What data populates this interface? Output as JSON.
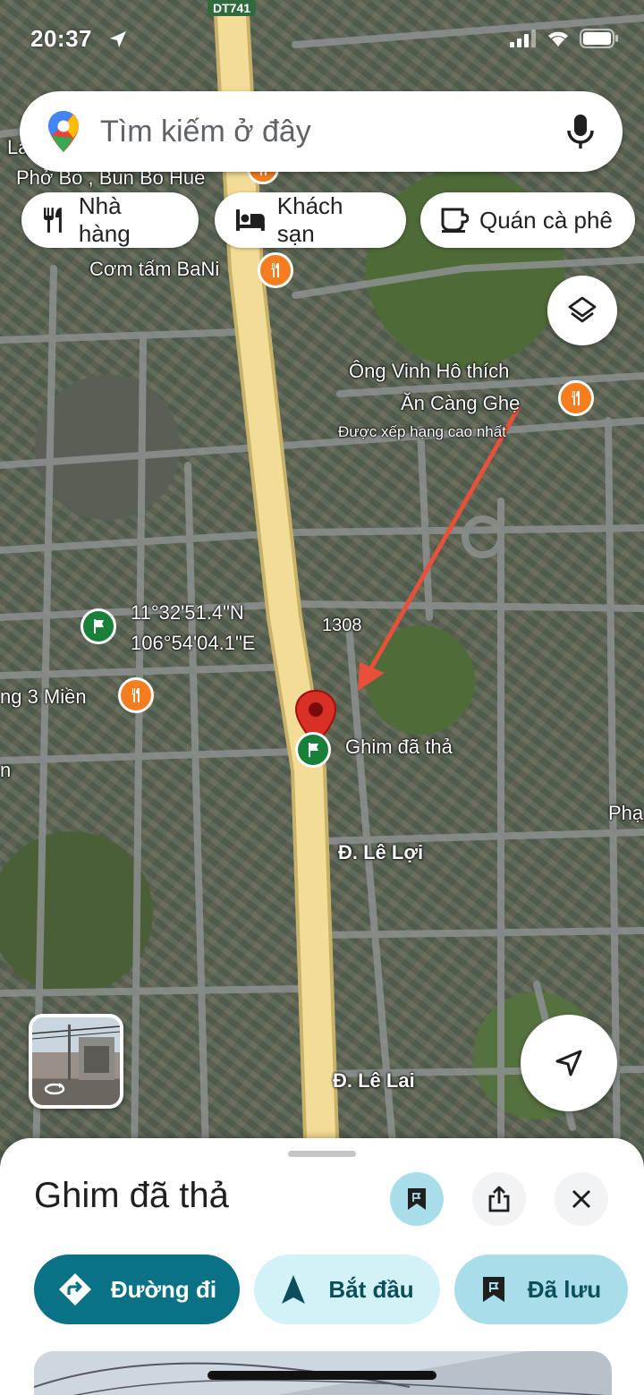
{
  "status_bar": {
    "time": "20:37"
  },
  "search": {
    "placeholder": "Tìm kiếm ở đây"
  },
  "chips": [
    {
      "label": "Nhà hàng",
      "icon": "restaurant-icon"
    },
    {
      "label": "Khách sạn",
      "icon": "hotel-icon"
    },
    {
      "label": "Quán cà phê",
      "icon": "coffee-icon"
    }
  ],
  "map": {
    "route_shield": "DT741",
    "labels": {
      "pho_bo": "Phở Bò , Bún Bò Huế",
      "la": "La",
      "com_tam": "Cơm tấm BaNi",
      "ong_vinh_1": "Ông Vinh Hô thích",
      "ong_vinh_2": "Ăn Càng Ghẹ",
      "top_rated": "Được xếp hạng cao nhất",
      "coord_lat": "11°32'51.4\"N",
      "coord_lng": "106°54'04.1\"E",
      "num_1308": "1308",
      "ong3mien": "ng 3 Miền",
      "n_edge": "n",
      "pin_label": "Ghim đã thả",
      "le_loi": "Đ. Lê Lợi",
      "le_lai": "Đ. Lê Lai",
      "pha_edge": "Phạ"
    },
    "colors": {
      "highway": "#f3dc95",
      "arrow": "#e8503a",
      "pin": "#d93025",
      "poi": "#f57c1f",
      "flag": "#188038"
    }
  },
  "sheet": {
    "title": "Ghim đã thả",
    "buttons": {
      "directions": "Đường đi",
      "start": "Bắt đầu",
      "saved": "Đã lưu"
    },
    "colors": {
      "primary": "#0b7285",
      "light": "#d3f2f8",
      "mid": "#a8dee9"
    }
  }
}
